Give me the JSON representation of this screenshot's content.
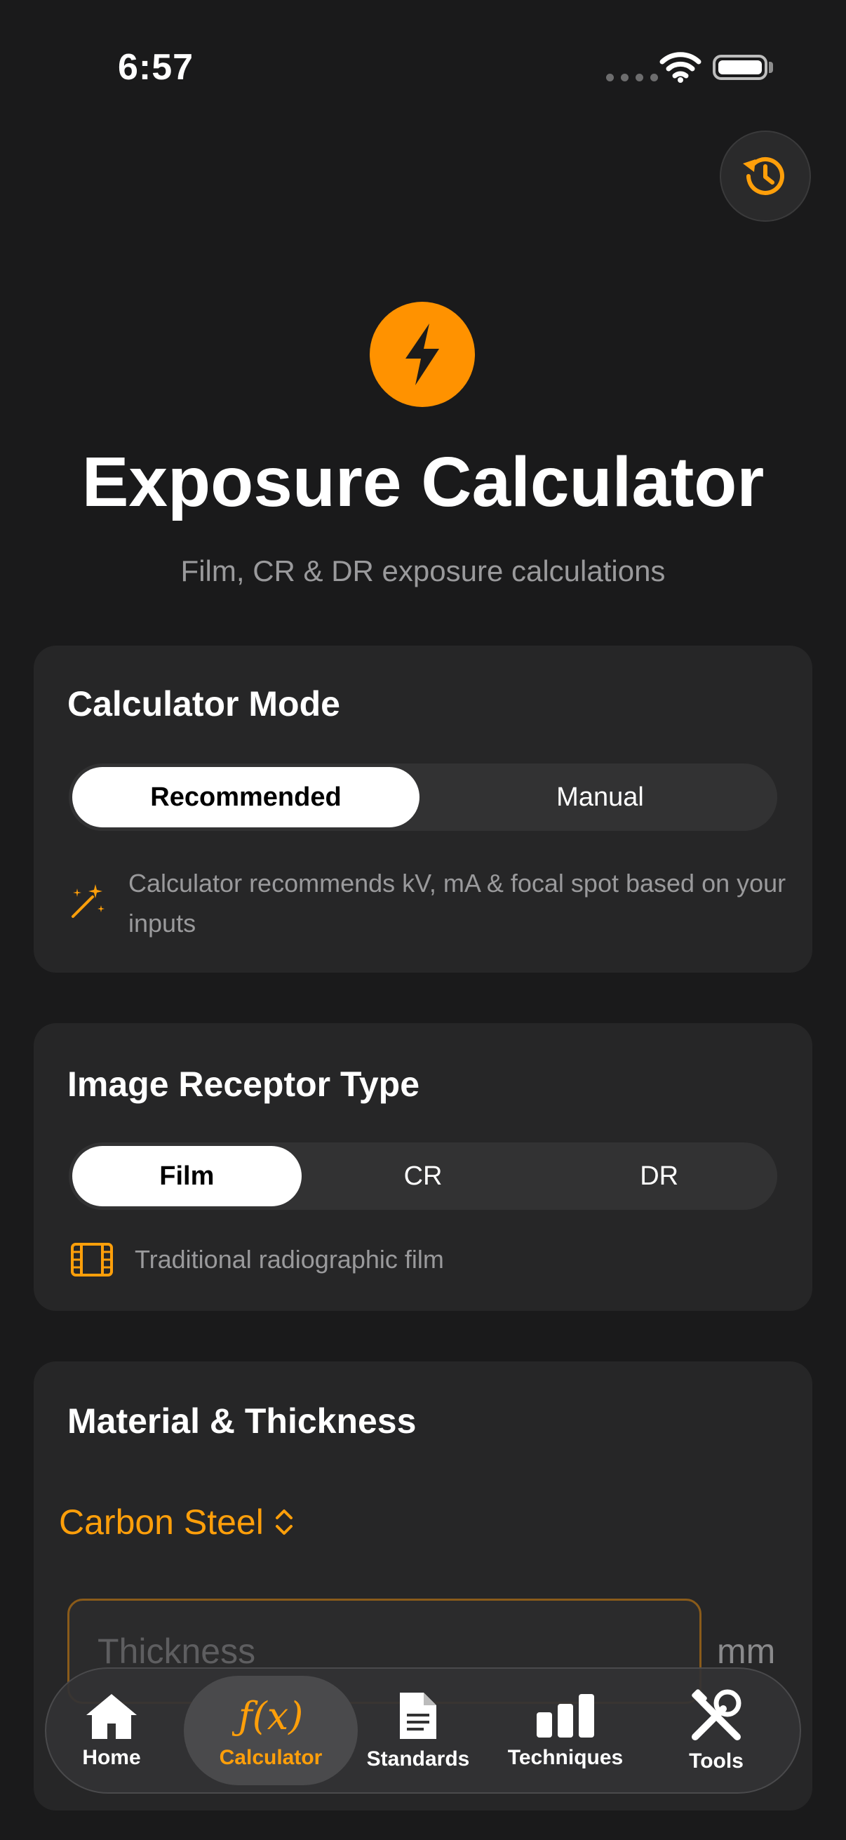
{
  "status_bar": {
    "time": "6:57"
  },
  "header": {
    "history_icon": "clock-history-icon",
    "app_icon": "lightning-bolt-icon",
    "title": "Exposure Calculator",
    "subtitle": "Film, CR & DR exposure calculations"
  },
  "calculator_mode": {
    "title": "Calculator Mode",
    "options": [
      "Recommended",
      "Manual"
    ],
    "selected": "Recommended",
    "hint_icon": "magic-wand-icon",
    "hint": "Calculator recommends kV, mA & focal spot based on your inputs"
  },
  "receptor_type": {
    "title": "Image Receptor Type",
    "options": [
      "Film",
      "CR",
      "DR"
    ],
    "selected": "Film",
    "hint_icon": "film-icon",
    "hint": "Traditional radiographic film"
  },
  "material": {
    "title": "Material & Thickness",
    "selected_material": "Carbon Steel",
    "thickness_placeholder": "Thickness",
    "thickness_value": "",
    "unit": "mm"
  },
  "tabbar": {
    "items": [
      {
        "label": "Home",
        "icon": "house-icon"
      },
      {
        "label": "Calculator",
        "icon": "function-icon"
      },
      {
        "label": "Standards",
        "icon": "document-icon"
      },
      {
        "label": "Techniques",
        "icon": "bar-chart-icon"
      },
      {
        "label": "Tools",
        "icon": "tools-icon"
      }
    ],
    "active": "Calculator"
  },
  "colors": {
    "accent": "#FF9F0A",
    "background": "#1A1A1B",
    "card": "#262627"
  }
}
